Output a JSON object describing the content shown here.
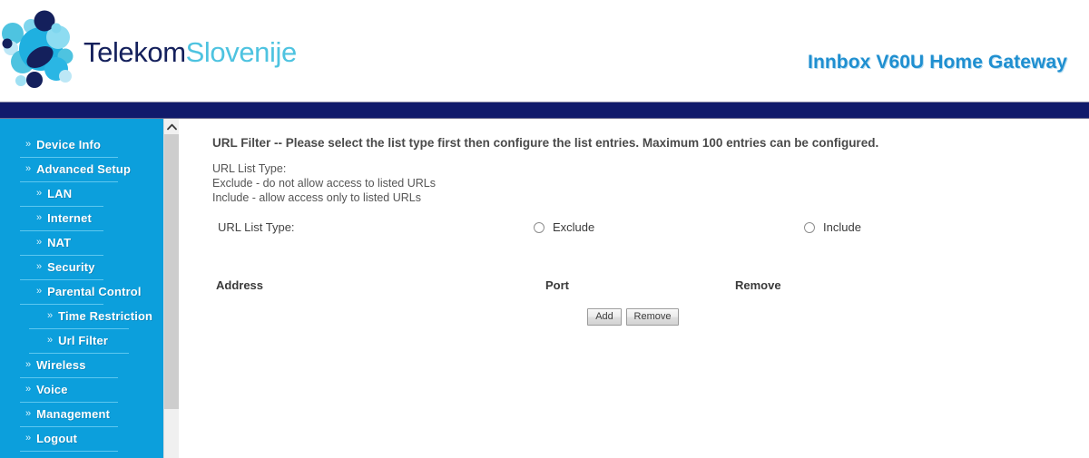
{
  "header": {
    "logo_text_primary": "Telekom",
    "logo_text_secondary": "Slovenije",
    "logo_icon": "telekom-slovenije-bubbles-logo",
    "device_title": "Innbox V60U Home Gateway",
    "colors": {
      "logo_primary": "#14205c",
      "logo_secondary": "#4ec3e0",
      "device_title": "#1f8fd0",
      "navbar": "#111a6b"
    }
  },
  "sidebar": {
    "background_color": "#0c9fdc",
    "chevron_glyph": "»",
    "items": [
      {
        "label": "Device Info",
        "level": 0
      },
      {
        "label": "Advanced Setup",
        "level": 0
      },
      {
        "label": "LAN",
        "level": 1
      },
      {
        "label": "Internet",
        "level": 1
      },
      {
        "label": "NAT",
        "level": 1
      },
      {
        "label": "Security",
        "level": 1
      },
      {
        "label": "Parental Control",
        "level": 1
      },
      {
        "label": "Time Restriction",
        "level": 2
      },
      {
        "label": "Url Filter",
        "level": 2
      },
      {
        "label": "Wireless",
        "level": 0
      },
      {
        "label": "Voice",
        "level": 0
      },
      {
        "label": "Management",
        "level": 0
      },
      {
        "label": "Logout",
        "level": 0
      }
    ]
  },
  "scrollbar": {
    "up_arrow_icon": "chevron-up-icon",
    "thumb_color": "#cdcdcd",
    "track_color": "#f0f0f0"
  },
  "main": {
    "intro": "URL Filter -- Please select the list type first then configure the list entries. Maximum 100 entries can be configured.",
    "description": [
      "URL List Type:",
      "Exclude - do not allow access to listed URLs",
      "Include - allow access only to listed URLs"
    ],
    "list_type": {
      "label": "URL List Type:",
      "options": [
        {
          "label": "Exclude",
          "selected": false
        },
        {
          "label": "Include",
          "selected": false
        }
      ]
    },
    "table": {
      "columns": [
        "Address",
        "Port",
        "Remove"
      ],
      "rows": []
    },
    "buttons": {
      "add": "Add",
      "remove": "Remove"
    }
  }
}
